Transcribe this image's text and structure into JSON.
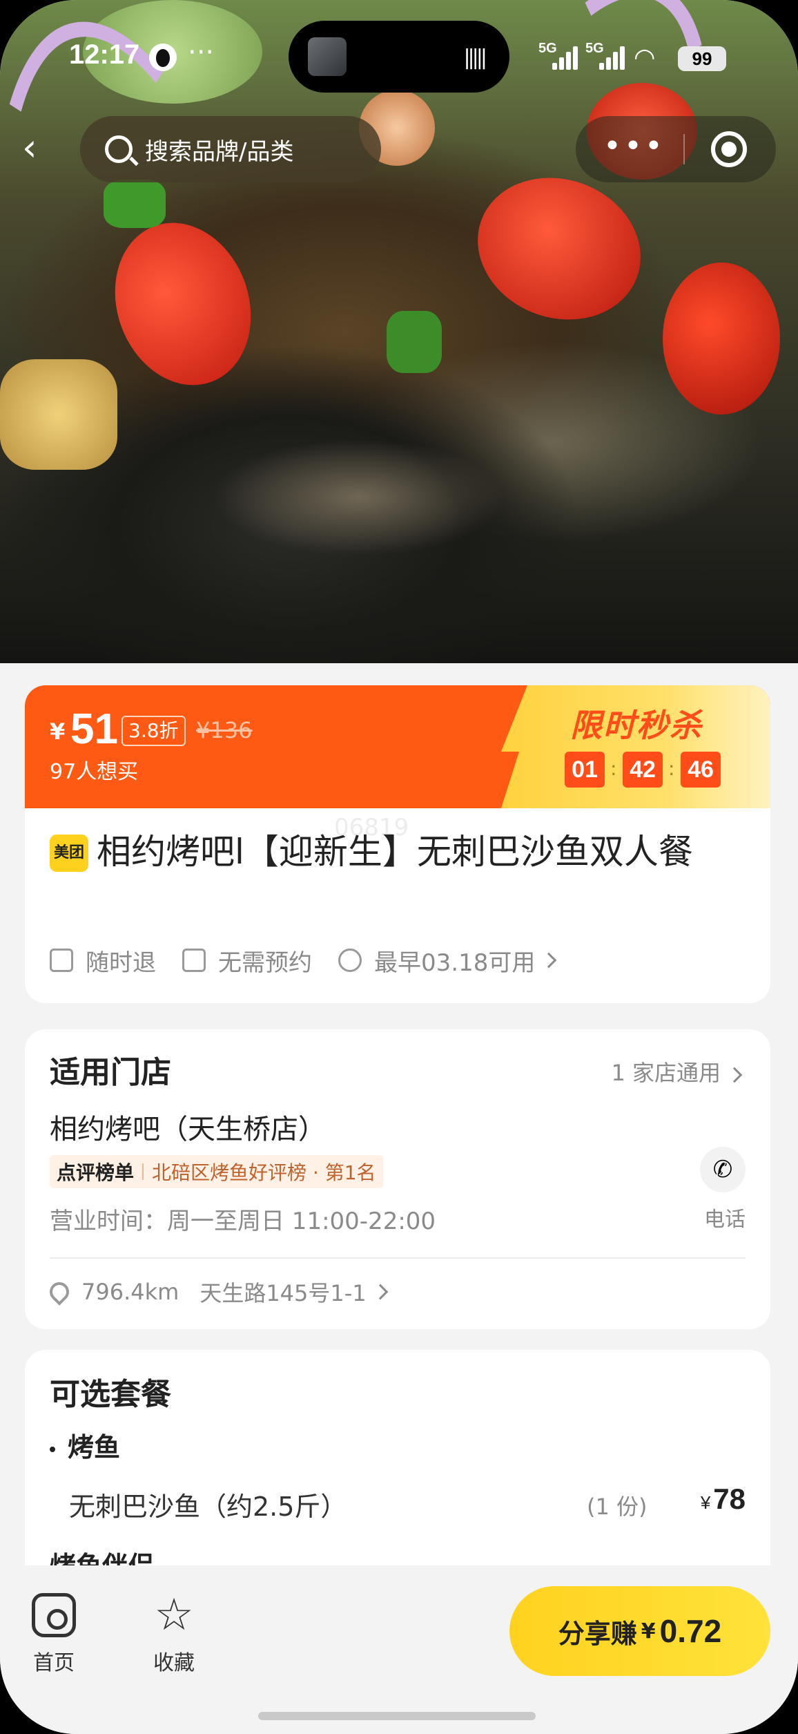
{
  "status_bar": {
    "time": "12:17",
    "dots": "···",
    "network_1": "5G",
    "network_2": "5G",
    "battery": "99"
  },
  "header": {
    "search_placeholder": "搜索品牌/品类",
    "more_label": "•••"
  },
  "deal": {
    "currency": "¥",
    "price": "51",
    "discount": "3.8折",
    "original_price": "¥136",
    "want_count": "97人想买",
    "flash_title": "限时秒杀",
    "countdown": {
      "hours": "01",
      "minutes": "42",
      "seconds": "46"
    },
    "watermark": "06819",
    "brand_badge": "美团",
    "title": "相约烤吧l【迎新生】无刺巴沙鱼双人餐",
    "tags": [
      "随时退",
      "无需预约",
      "最早03.18可用"
    ]
  },
  "store": {
    "heading": "适用门店",
    "count": "1 家店通用",
    "name": "相约烤吧（天生桥店）",
    "rank_badge": "点评榜单",
    "rank_text": "北碚区烤鱼好评榜 · 第1名",
    "hours": "营业时间：周一至周日 11:00-22:00",
    "phone_label": "电话",
    "distance": "796.4km",
    "address": "天生路145号1-1"
  },
  "package": {
    "heading": "可选套餐",
    "category_1": "烤鱼",
    "item_name": "无刺巴沙鱼（约2.5斤）",
    "item_qty": "(1 份)",
    "item_currency": "¥",
    "item_price": "78",
    "category_2": "烤鱼伴侣"
  },
  "bottom_bar": {
    "home_label": "首页",
    "fav_label": "收藏",
    "share_label": "分享赚",
    "share_currency": "¥",
    "share_amount": "0.72"
  },
  "colors": {
    "accent_orange": "#ff5a14",
    "accent_yellow": "#ffd21f"
  }
}
